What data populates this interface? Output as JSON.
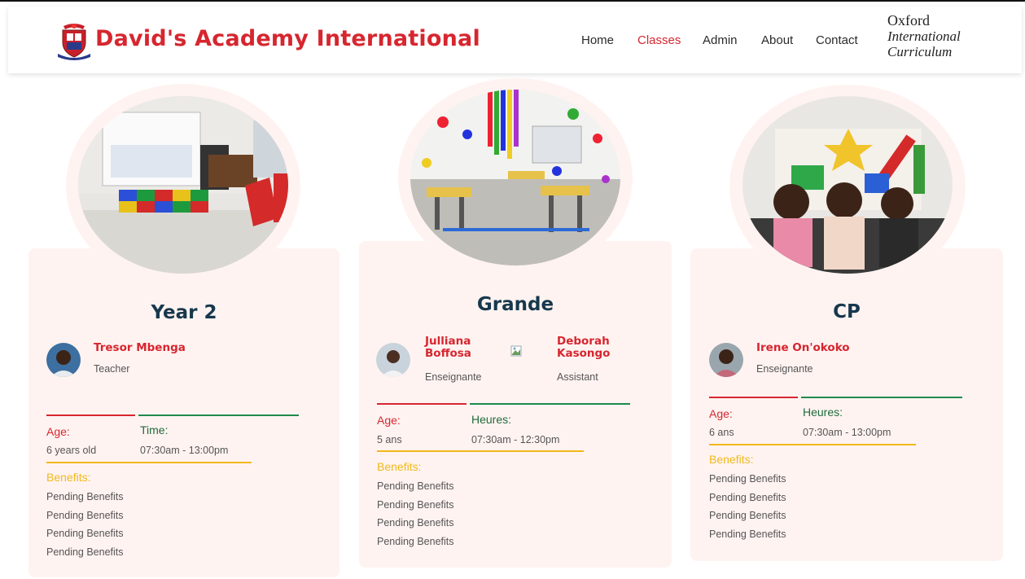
{
  "header": {
    "brand": "David's Academy International",
    "nav": [
      "Home",
      "Classes",
      "Admin",
      "About",
      "Contact"
    ],
    "active_nav": "Classes",
    "oxford": [
      "Oxford",
      "International",
      "Curriculum"
    ]
  },
  "classes": [
    {
      "title": "Year 2",
      "staff": [
        {
          "name": "Tresor Mbenga",
          "role": "Teacher"
        }
      ],
      "age_label": "Age:",
      "age_value": "6 years old",
      "time_label": "Time:",
      "time_value": "07:30am - 13:00pm",
      "benefits_label": "Benefits:",
      "benefits": [
        "Pending Benefits",
        "Pending Benefits",
        "Pending Benefits",
        "Pending Benefits"
      ]
    },
    {
      "title": "Grande",
      "staff": [
        {
          "name_line1": "Julliana",
          "name_line2": "Boffosa",
          "role": "Enseignante"
        },
        {
          "name_line1": "Deborah",
          "name_line2": "Kasongo",
          "role": "Assistant"
        }
      ],
      "age_label": "Age:",
      "age_value": "5 ans",
      "time_label": "Heures:",
      "time_value": "07:30am - 12:30pm",
      "benefits_label": "Benefits:",
      "benefits": [
        "Pending Benefits",
        "Pending Benefits",
        "Pending Benefits",
        "Pending Benefits"
      ]
    },
    {
      "title": "CP",
      "staff": [
        {
          "name": "Irene On'okoko",
          "role": "Enseignante"
        }
      ],
      "age_label": "Age:",
      "age_value": "6 ans",
      "time_label": "Heures:",
      "time_value": "07:30am - 13:00pm",
      "benefits_label": "Benefits:",
      "benefits": [
        "Pending Benefits",
        "Pending Benefits",
        "Pending Benefits",
        "Pending Benefits"
      ]
    }
  ],
  "colors": {
    "brand_red": "#d6262f",
    "green": "#1f8a4c",
    "yellow": "#f1b91a",
    "card_bg": "#fff3f1",
    "title_navy": "#17384d"
  },
  "icons": [
    "school-crest-icon",
    "broken-image-icon"
  ]
}
